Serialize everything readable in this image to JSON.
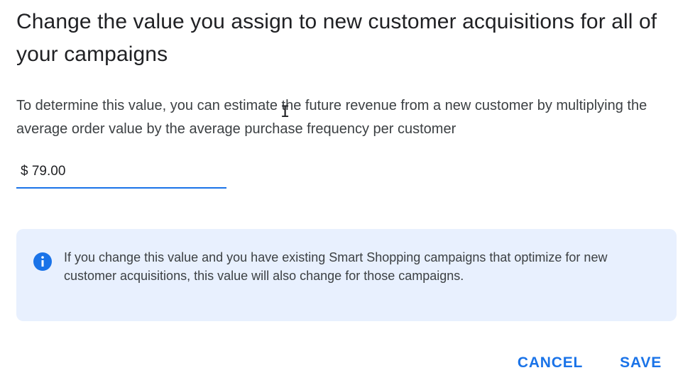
{
  "dialog": {
    "title": "Change the value you assign to new customer acquisitions for all of your campaigns",
    "description": "To determine this value, you can estimate the future revenue from a new customer by multiplying the average order value by the average purchase frequency per customer",
    "value_input": {
      "value": "$ 79.00"
    },
    "info": {
      "icon": "info-icon",
      "text": "If you change this value and you have existing Smart Shopping campaigns that optimize for new customer acquisitions, this value will also change for those campaigns."
    },
    "actions": {
      "cancel_label": "CANCEL",
      "save_label": "SAVE"
    }
  },
  "colors": {
    "accent": "#1a73e8",
    "info_background": "#e8f0fe",
    "text_primary": "#202124",
    "text_secondary": "#3c4043"
  }
}
